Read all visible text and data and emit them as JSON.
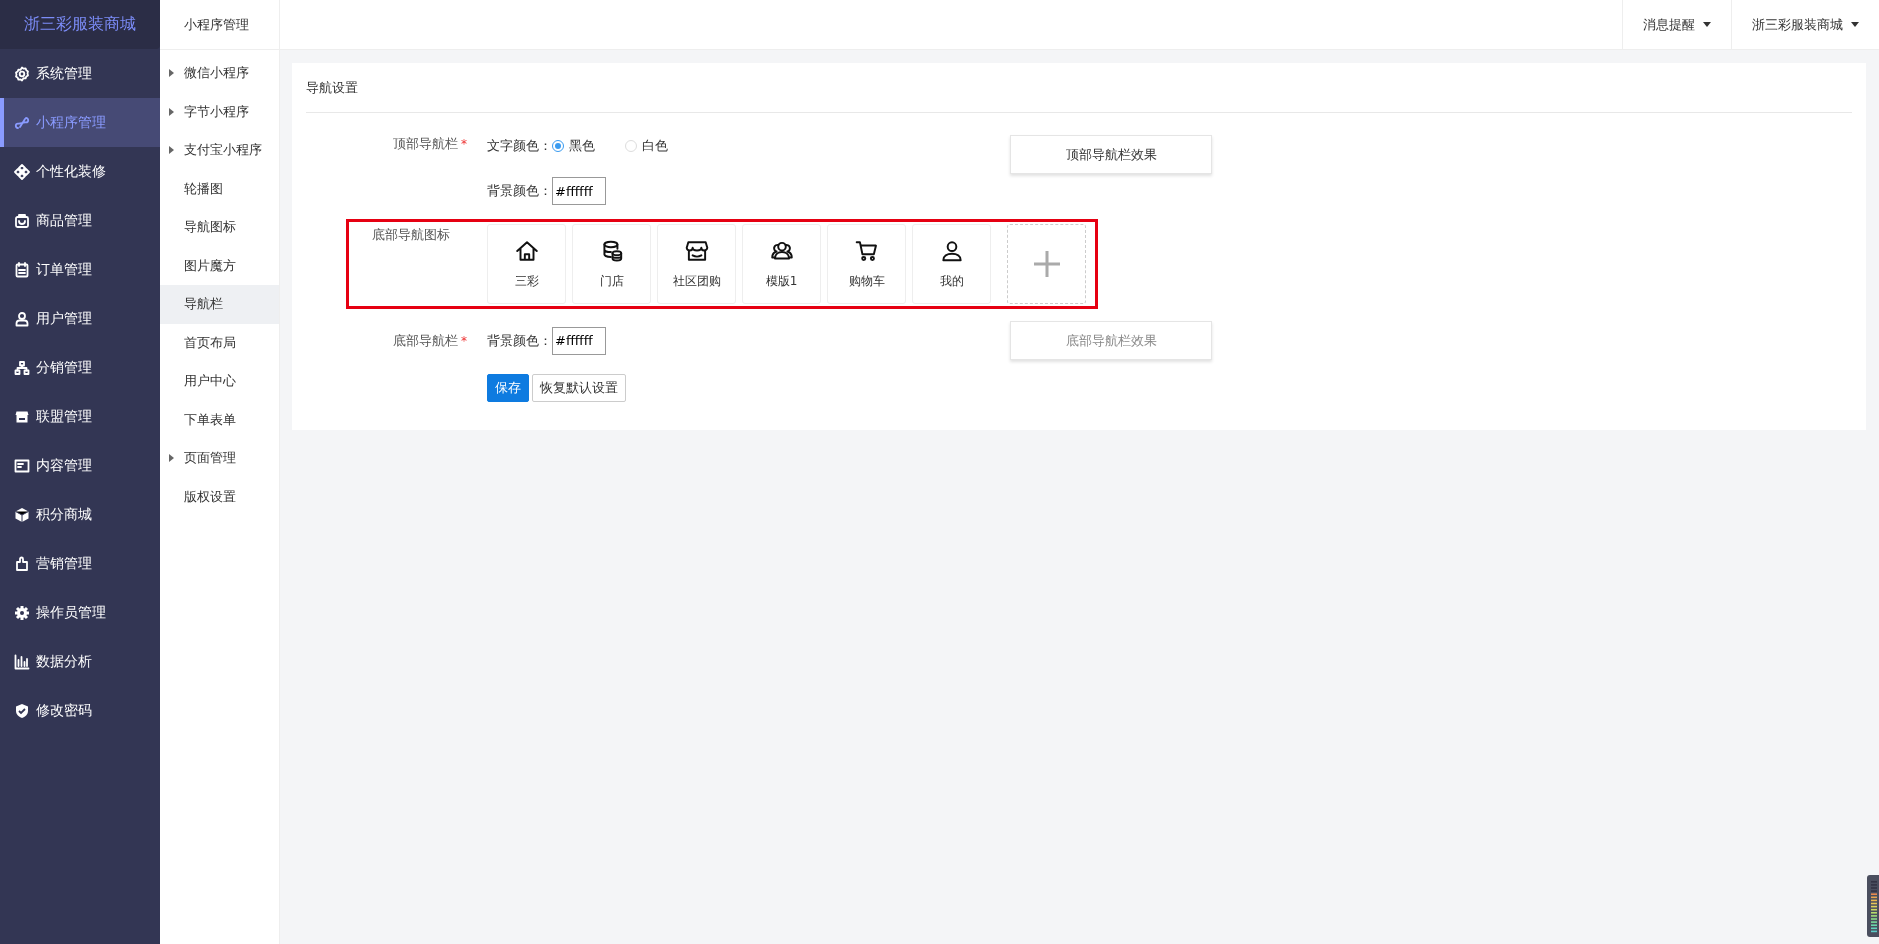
{
  "sidebar": {
    "logo": "浙三彩服装商城",
    "items": [
      {
        "label": "系统管理",
        "selected": false
      },
      {
        "label": "小程序管理",
        "selected": true
      },
      {
        "label": "个性化装修",
        "selected": false
      },
      {
        "label": "商品管理",
        "selected": false
      },
      {
        "label": "订单管理",
        "selected": false
      },
      {
        "label": "用户管理",
        "selected": false
      },
      {
        "label": "分销管理",
        "selected": false
      },
      {
        "label": "联盟管理",
        "selected": false
      },
      {
        "label": "内容管理",
        "selected": false
      },
      {
        "label": "积分商城",
        "selected": false
      },
      {
        "label": "营销管理",
        "selected": false
      },
      {
        "label": "操作员管理",
        "selected": false
      },
      {
        "label": "数据分析",
        "selected": false
      },
      {
        "label": "修改密码",
        "selected": false
      }
    ]
  },
  "submenu": {
    "title": "小程序管理",
    "items": [
      {
        "label": "微信小程序",
        "expandable": true,
        "selected": false
      },
      {
        "label": "字节小程序",
        "expandable": true,
        "selected": false
      },
      {
        "label": "支付宝小程序",
        "expandable": true,
        "selected": false
      },
      {
        "label": "轮播图",
        "expandable": false,
        "selected": false
      },
      {
        "label": "导航图标",
        "expandable": false,
        "selected": false
      },
      {
        "label": "图片魔方",
        "expandable": false,
        "selected": false
      },
      {
        "label": "导航栏",
        "expandable": false,
        "selected": true
      },
      {
        "label": "首页布局",
        "expandable": false,
        "selected": false
      },
      {
        "label": "用户中心",
        "expandable": false,
        "selected": false
      },
      {
        "label": "下单表单",
        "expandable": false,
        "selected": false
      },
      {
        "label": "页面管理",
        "expandable": true,
        "selected": false
      },
      {
        "label": "版权设置",
        "expandable": false,
        "selected": false
      }
    ]
  },
  "topbar": {
    "menus": [
      "消息提醒",
      "浙三彩服装商城"
    ]
  },
  "panel": {
    "title": "导航设置",
    "top_nav": {
      "label": "顶部导航栏",
      "required_mark": "*",
      "text_color_label": "文字颜色：",
      "options": [
        {
          "label": "黑色",
          "selected": true
        },
        {
          "label": "白色",
          "selected": false
        }
      ],
      "bg_label": "背景颜色：",
      "bg_value": "#ffffff",
      "preview_button": {
        "label": "顶部导航栏效果",
        "disabled": false
      }
    },
    "bottom_icons": {
      "label": "底部导航图标",
      "highlighted": true,
      "items": [
        {
          "label": "三彩"
        },
        {
          "label": "门店"
        },
        {
          "label": "社区团购"
        },
        {
          "label": "模版1"
        },
        {
          "label": "购物车"
        },
        {
          "label": "我的"
        }
      ],
      "add_tile": true
    },
    "bottom_nav": {
      "label": "底部导航栏",
      "required_mark": "*",
      "bg_label": "背景颜色：",
      "bg_value": "#ffffff",
      "preview_button": {
        "label": "底部导航栏效果",
        "disabled": true
      }
    },
    "buttons": [
      {
        "label": "保存",
        "kind": "primary"
      },
      {
        "label": "恢复默认设置",
        "kind": "default"
      }
    ]
  }
}
